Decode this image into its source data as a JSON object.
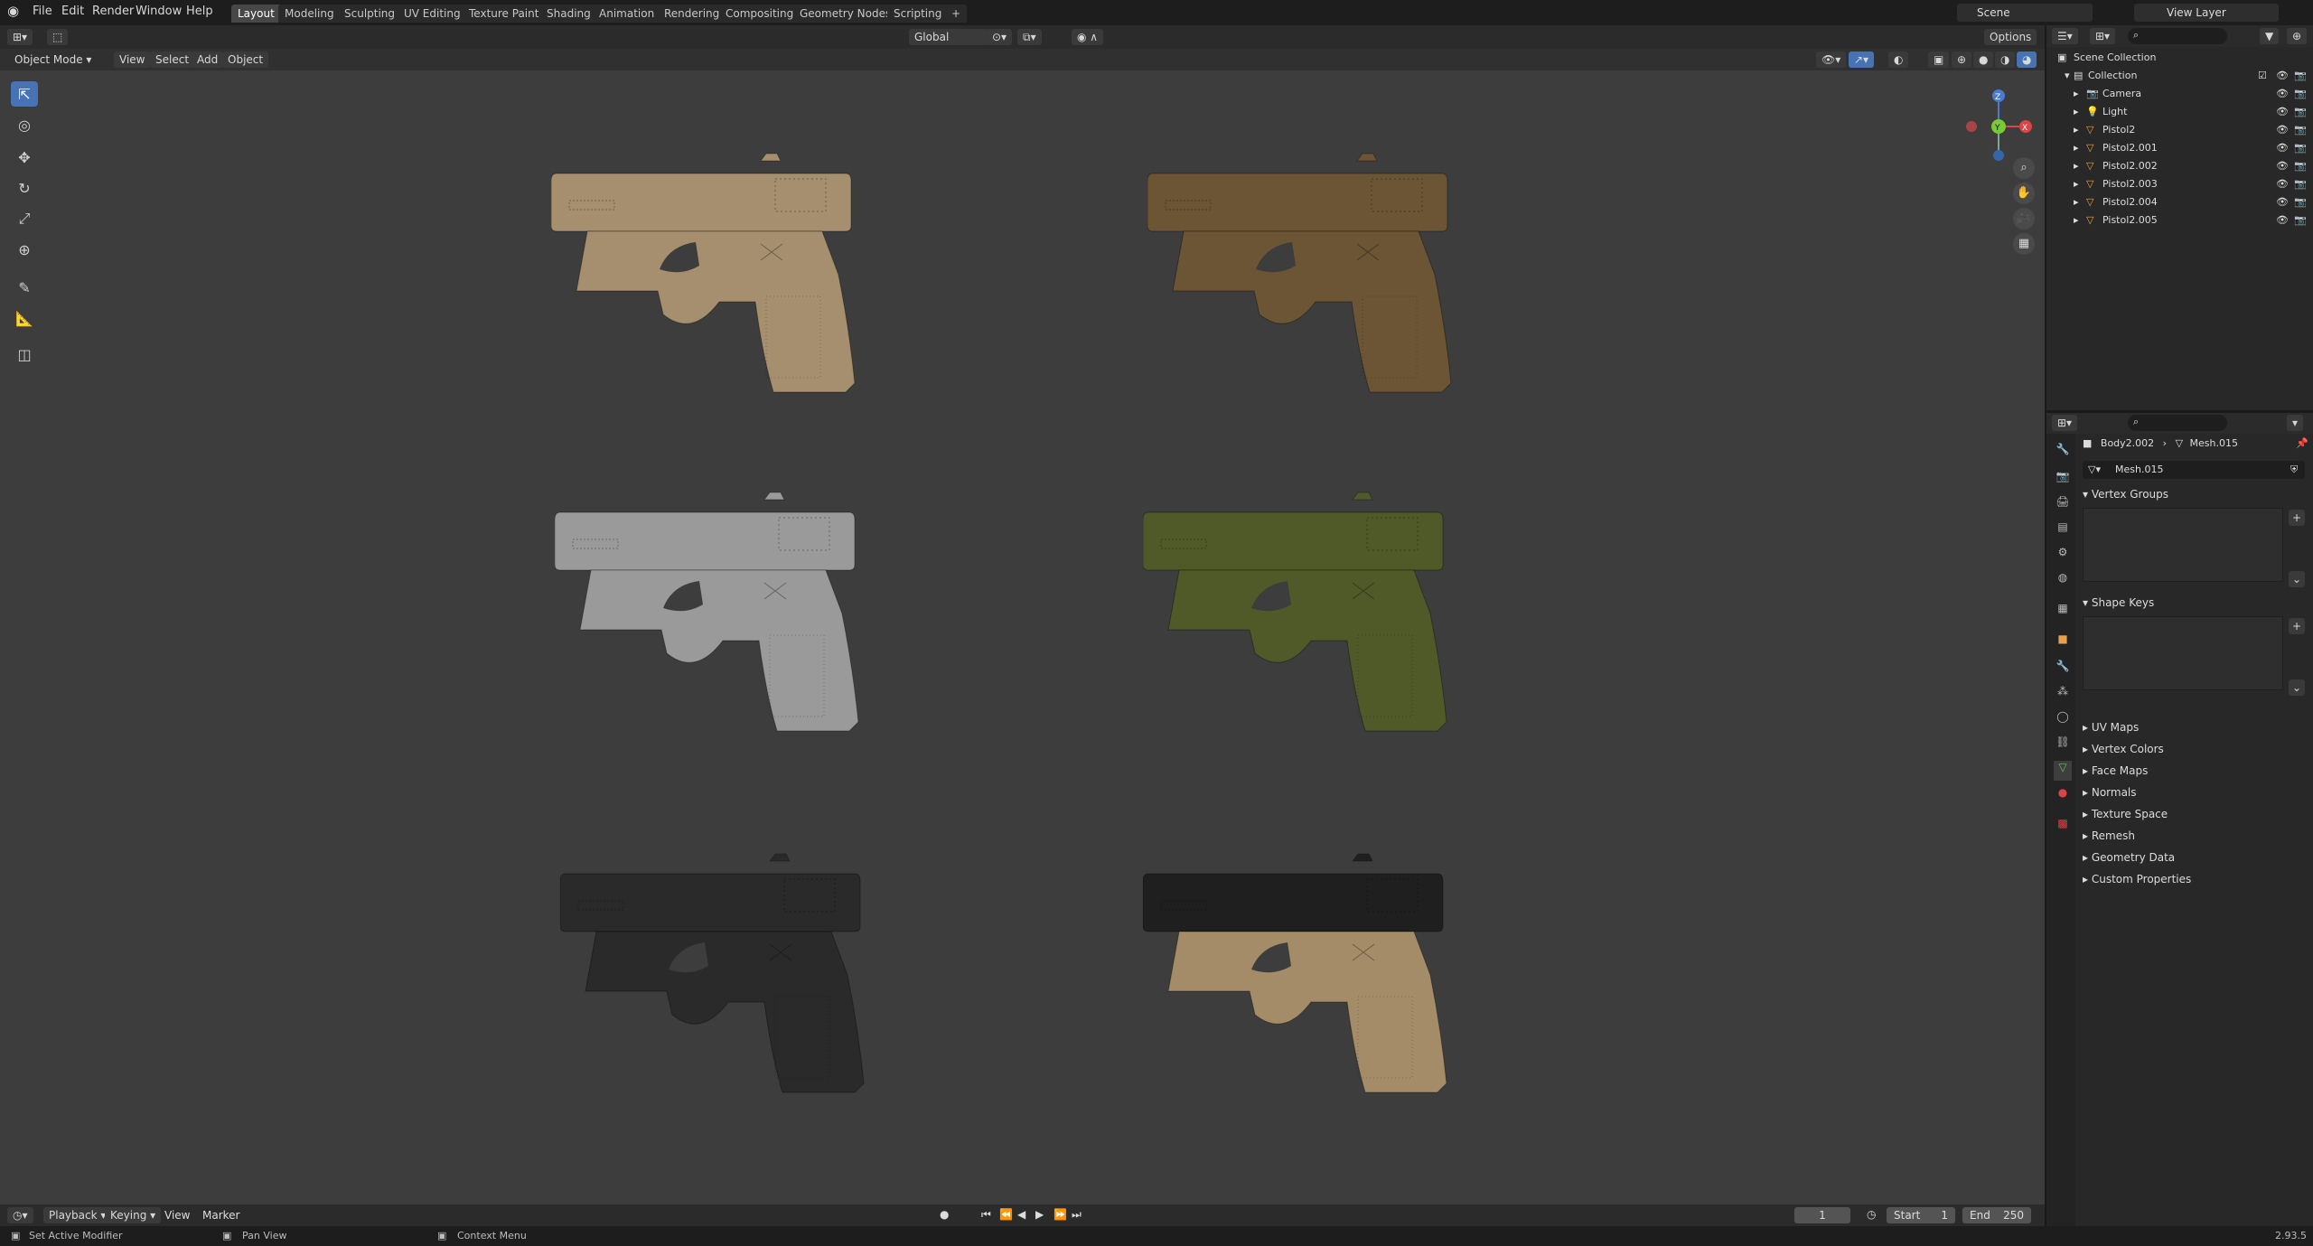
{
  "menu": {
    "items": [
      "File",
      "Edit",
      "Render",
      "Window",
      "Help"
    ]
  },
  "workspaces": [
    "Layout",
    "Modeling",
    "Sculpting",
    "UV Editing",
    "Texture Paint",
    "Shading",
    "Animation",
    "Rendering",
    "Compositing",
    "Geometry Nodes",
    "Scripting"
  ],
  "scene": {
    "name": "Scene",
    "view_layer": "View Layer"
  },
  "header": {
    "mode": "Object Mode",
    "view": "View",
    "select": "Select",
    "add": "Add",
    "object": "Object",
    "orientation": "Global",
    "options": "Options"
  },
  "outliner": {
    "root": "Scene Collection",
    "collection": "Collection",
    "items": [
      "Camera",
      "Light",
      "Pistol2",
      "Pistol2.001",
      "Pistol2.002",
      "Pistol2.003",
      "Pistol2.004",
      "Pistol2.005"
    ]
  },
  "properties": {
    "breadcrumb_object": "Body2.002",
    "breadcrumb_mesh": "Mesh.015",
    "mesh_name": "Mesh.015",
    "sections": {
      "vertex_groups": "Vertex Groups",
      "shape_keys": "Shape Keys",
      "uv_maps": "UV Maps",
      "vertex_colors": "Vertex Colors",
      "face_maps": "Face Maps",
      "normals": "Normals",
      "texture_space": "Texture Space",
      "remesh": "Remesh",
      "geometry_data": "Geometry Data",
      "custom_properties": "Custom Properties"
    }
  },
  "timeline": {
    "playback": "Playback",
    "keying": "Keying",
    "view": "View",
    "marker": "Marker",
    "current_frame": "1",
    "start_label": "Start",
    "start": "1",
    "end_label": "End",
    "end": "250"
  },
  "status": {
    "left": "Set Active Modifier",
    "middle": "Pan View",
    "right": "Context Menu",
    "version": "2.93.5"
  },
  "colors": {
    "accent": "#4772b3",
    "pistol_tan": "#a58f6e",
    "pistol_brown": "#6b5535",
    "pistol_grey": "#9a9a9a",
    "pistol_green": "#4f5a28",
    "pistol_black": "#2a2a2a",
    "pistol_two_tone_slide": "#1f1f1f",
    "pistol_two_tone_frame": "#a48c68"
  }
}
